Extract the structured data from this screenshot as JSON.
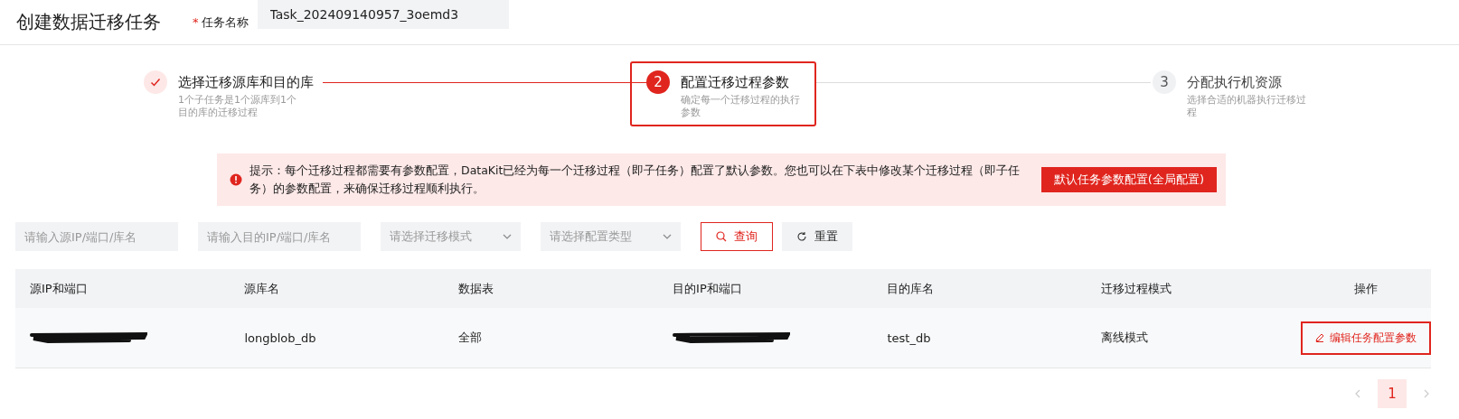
{
  "page_title": "创建数据迁移任务",
  "task_name": {
    "required_mark": "*",
    "label": "任务名称",
    "value": "Task_202409140957_3oemd3"
  },
  "steps": [
    {
      "title": "选择迁移源库和目的库",
      "description": "1个子任务是1个源库到1个目的库的迁移过程",
      "done": true,
      "selected": false,
      "highlighted": false
    },
    {
      "number": "2",
      "title": "配置迁移过程参数",
      "description": "确定每一个迁移过程的执行参数",
      "done": false,
      "selected": true,
      "highlighted": true
    },
    {
      "number": "3",
      "title": "分配执行机资源",
      "description": "选择合适的机器执行迁移过程",
      "done": false,
      "selected": false,
      "highlighted": false
    }
  ],
  "alert": {
    "text": "提示：每个迁移过程都需要有参数配置，DataKit已经为每一个迁移过程（即子任务）配置了默认参数。您也可以在下表中修改某个迁移过程（即子任务）的参数配置，来确保迁移过程顺利执行。",
    "button": "默认任务参数配置(全局配置)"
  },
  "filters": [
    {
      "kind": "input",
      "placeholder": "请输入源IP/端口/库名"
    },
    {
      "kind": "input",
      "placeholder": "请输入目的IP/端口/库名"
    },
    {
      "kind": "select",
      "placeholder": "请选择迁移模式"
    },
    {
      "kind": "select",
      "placeholder": "请选择配置类型"
    }
  ],
  "search_button": "查询",
  "reset_button": "重置",
  "table": {
    "columns": [
      "源IP和端口",
      "源库名",
      "数据表",
      "目的IP和端口",
      "目的库名",
      "迁移过程模式",
      "操作"
    ],
    "rows": [
      {
        "cells": [
          {
            "redacted": true
          },
          {
            "text": "longblob_db"
          },
          {
            "text": "全部"
          },
          {
            "redacted": true
          },
          {
            "text": "test_db"
          },
          {
            "text": "离线模式"
          }
        ],
        "action": "编辑任务配置参数",
        "action_highlighted": true
      }
    ]
  },
  "pagination": {
    "pages": [
      {
        "label": "1",
        "selected": true
      }
    ]
  }
}
